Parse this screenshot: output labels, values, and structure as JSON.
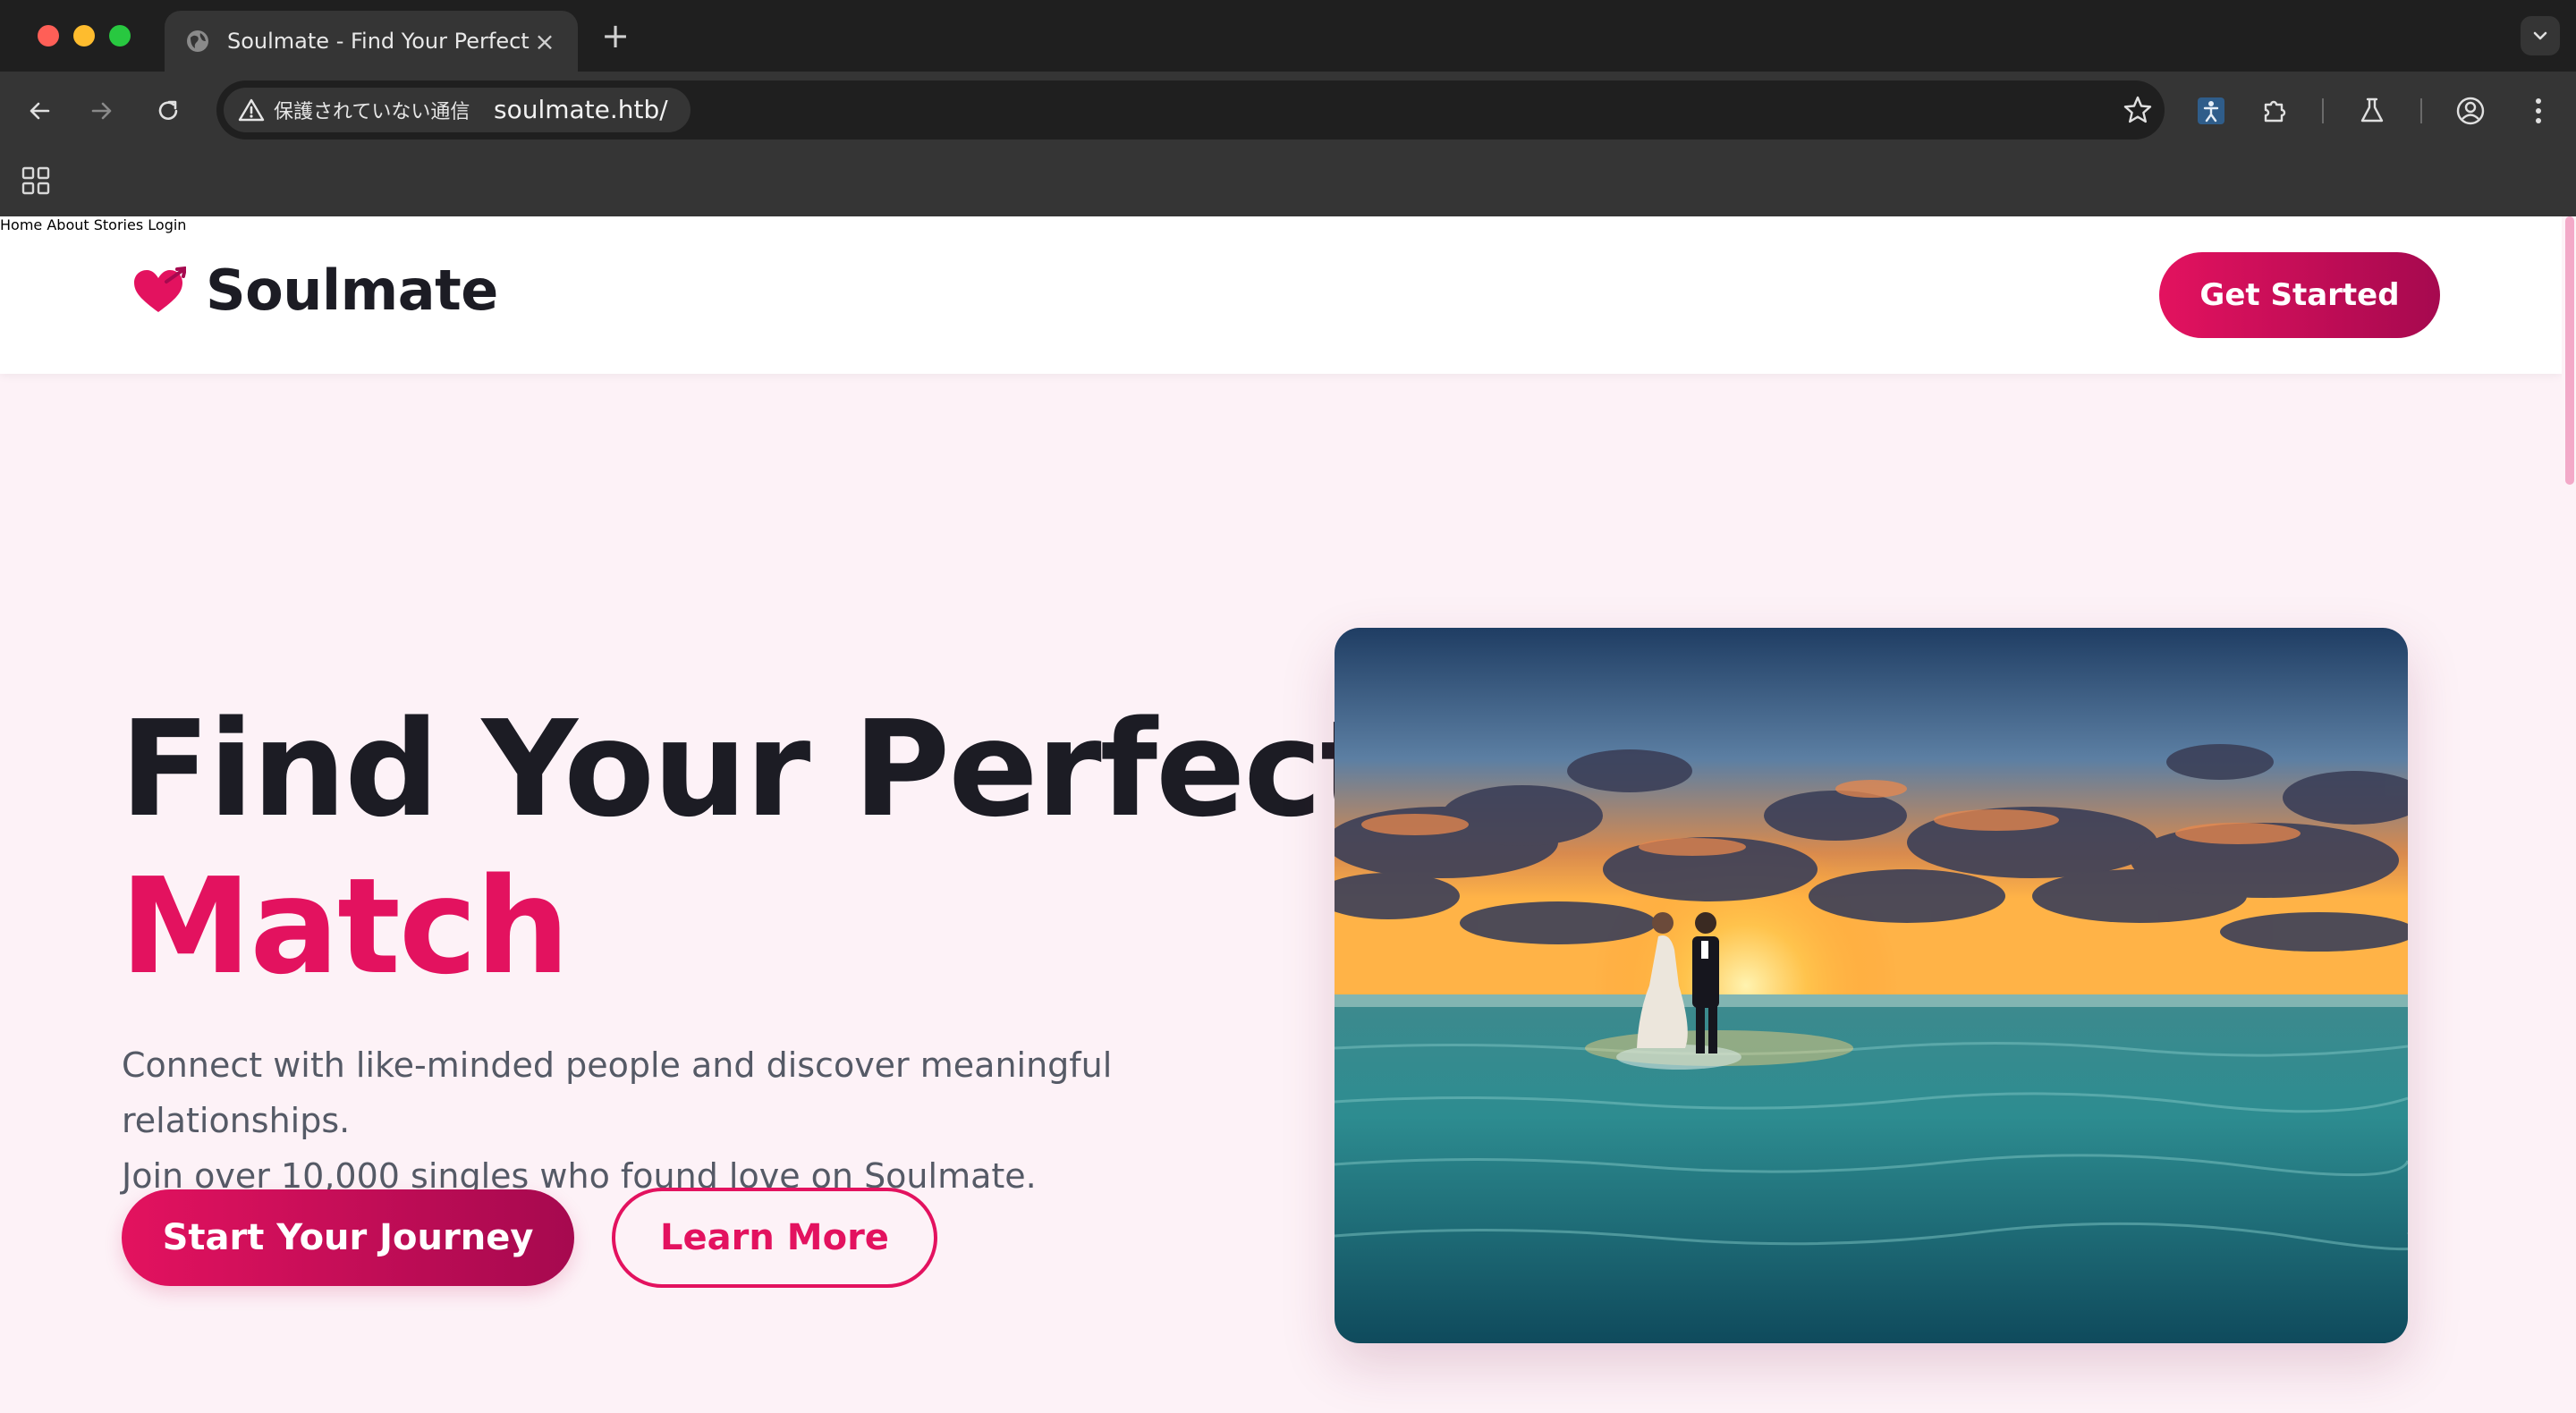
{
  "browser": {
    "tab_title": "Soulmate - Find Your Perfect",
    "tab_close": "×",
    "new_tab": "+",
    "security_label": "保護されていない通信",
    "url": "soulmate.htb/"
  },
  "site": {
    "brand": "Soulmate",
    "nav": [
      "Home",
      "About",
      "Stories",
      "Login"
    ],
    "cta": "Get Started"
  },
  "hero": {
    "title_line1": "Find Your Perfect",
    "title_accent": "Match",
    "description_line1": "Connect with like-minded people and discover meaningful relationships.",
    "description_line2": "Join over 10,000 singles who found love on Soulmate.",
    "primary_button": "Start Your Journey",
    "secondary_button": "Learn More"
  },
  "colors": {
    "accent": "#e3125f",
    "accent_dark": "#a6094f",
    "page_bg": "#fdf2f7",
    "heading": "#1c1c24",
    "body_text": "#555a66"
  }
}
